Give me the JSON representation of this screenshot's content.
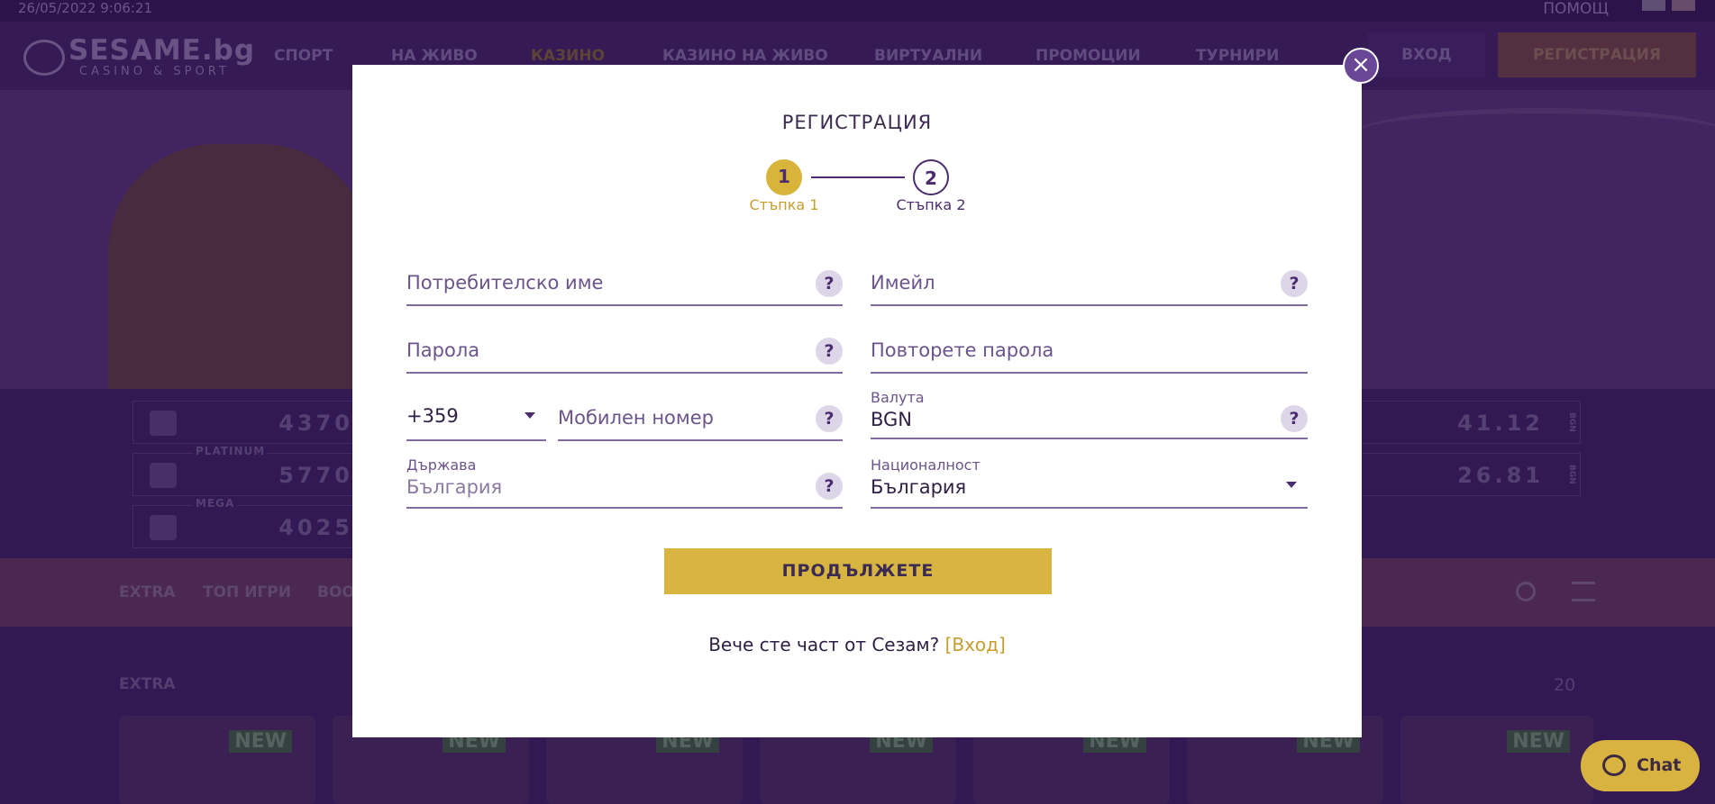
{
  "topbar": {
    "date": "26/05/2022 9:06:21",
    "help": "ПОМОЩ"
  },
  "header": {
    "logo_main": "SESAME.bg",
    "logo_sub": "CASINO & SPORT",
    "nav": [
      "СПОРТ",
      "НА ЖИВО",
      "КАЗИНО",
      "КАЗИНО НА ЖИВО",
      "ВИРТУАЛНИ",
      "ПРОМОЦИИ",
      "ТУРНИРИ"
    ],
    "login": "ВХОД",
    "register": "РЕГИСТРАЦИЯ"
  },
  "jackpots": [
    {
      "value": "4370",
      "label": ""
    },
    {
      "value": "5770",
      "label": "PLATINUM"
    },
    {
      "value": "4025",
      "label": "MEGA"
    },
    {
      "value": "41.12",
      "currency": "BGN"
    },
    {
      "value": "26.81",
      "currency": "BGN"
    }
  ],
  "categories": [
    "EXTRA",
    "ТОП ИГРИ",
    "BOO"
  ],
  "section": {
    "title": "EXTRA",
    "count": "20"
  },
  "tile_badge": "NEW",
  "chat": {
    "label": "Chat"
  },
  "modal": {
    "title": "РЕГИСТРАЦИЯ",
    "steps": [
      {
        "number": "1",
        "label": "Стъпка 1"
      },
      {
        "number": "2",
        "label": "Стъпка 2"
      }
    ],
    "fields": {
      "username": "Потребителско име",
      "email": "Имейл",
      "password": "Парола",
      "repeat_password": "Повторете парола",
      "phone_code": "+359",
      "mobile": "Мобилен номер",
      "currency_label": "Валута",
      "currency_value": "BGN",
      "country_label": "Държава",
      "country_value": "България",
      "nationality_label": "Националност",
      "nationality_value": "България"
    },
    "help": "?",
    "continue": "ПРОДЪЛЖЕТЕ",
    "already_member": "Вече сте част от Сезам?",
    "login_link": "[Вход]",
    "close": "×"
  }
}
